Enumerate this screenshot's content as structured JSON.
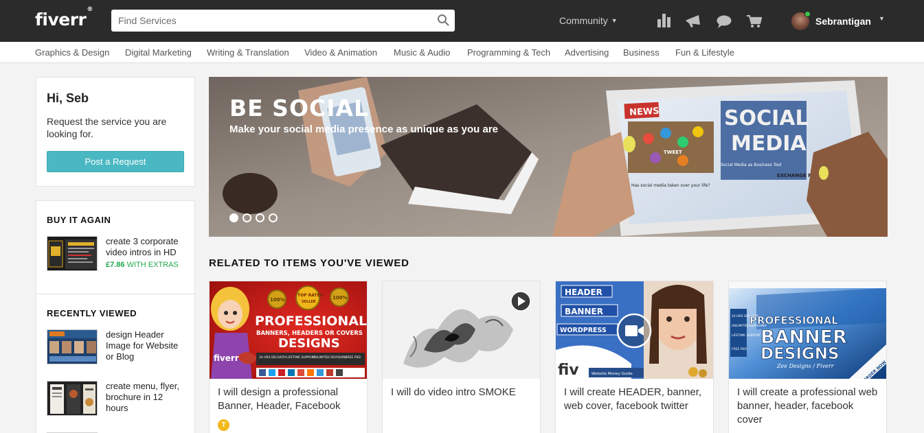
{
  "header": {
    "logo": "fiverr",
    "logo_mark": "®",
    "search_placeholder": "Find Services",
    "community": "Community",
    "username": "Sebrantigan"
  },
  "categories": [
    "Graphics & Design",
    "Digital Marketing",
    "Writing & Translation",
    "Video & Animation",
    "Music & Audio",
    "Programming & Tech",
    "Advertising",
    "Business",
    "Fun & Lifestyle"
  ],
  "sidebar": {
    "greeting": "Hi, Seb",
    "request_text": "Request the service you are looking for.",
    "post_button": "Post a Request",
    "buy_again": {
      "title": "BUY IT AGAIN",
      "item_title": "create 3 corporate video intros in HD",
      "price": "£7.86",
      "price_suffix": "WITH EXTRAS"
    },
    "recently_viewed": {
      "title": "RECENTLY VIEWED",
      "items": [
        "design Header Image for Website or Blog",
        "create menu, flyer, brochure in 12 hours"
      ]
    }
  },
  "hero": {
    "title": "BE SOCIAL",
    "subtitle": "Make your social media presence as unique as you are",
    "slides": 4,
    "active_slide": 1,
    "image_text": {
      "news": "NEWS",
      "social_media": "SOCIAL MEDIA",
      "tweet": "TWEET",
      "headline": "Has social media taken over your life?",
      "sub_headline": "Social Media as Business Tool",
      "exchange_rate": "EXCHANGE RATE"
    }
  },
  "related": {
    "title": "RELATED TO ITEMS YOU'VE VIEWED",
    "gigs": [
      {
        "title": "I will design a professional Banner, Header, Facebook",
        "badge": "T",
        "image_text": {
          "main": "PROFESSIONAL",
          "sub": "BANNERS, HEADERS OR COVERS",
          "main2": "DESIGNS",
          "seal1": "100%",
          "seal2": "TOP RATED",
          "seal2_sub": "SELLER",
          "seal3": "100%",
          "brand": "fiverr",
          "features": [
            "24 HRS DELIVERY",
            "LIFETIME SUPPORT",
            "UNLIMITED REVISIONS",
            "FREE PSD"
          ]
        }
      },
      {
        "title": "I will do video intro SMOKE",
        "badge": ""
      },
      {
        "title": "I will create HEADER, banner, web cover, facebook twitter",
        "badge": "",
        "image_text": {
          "labels": [
            "HEADER",
            "BANNER",
            "WORDPRESS"
          ],
          "brand": "fiv",
          "caption": "Website Money Guide"
        }
      },
      {
        "title": "I will create a professional web banner, header, facebook cover",
        "badge": "",
        "image_text": {
          "line1": "PROFESSIONAL",
          "line2": "BANNER",
          "line3": "DESIGNS",
          "sig": "Zee Designs / Fiverr",
          "ribbon": "ORDER NOW",
          "features": [
            "24 HRS DELIVERY",
            "UNLIMITED REVISIONS",
            "LIFETIME SUPPORT",
            "FREE PSD"
          ]
        }
      }
    ]
  }
}
